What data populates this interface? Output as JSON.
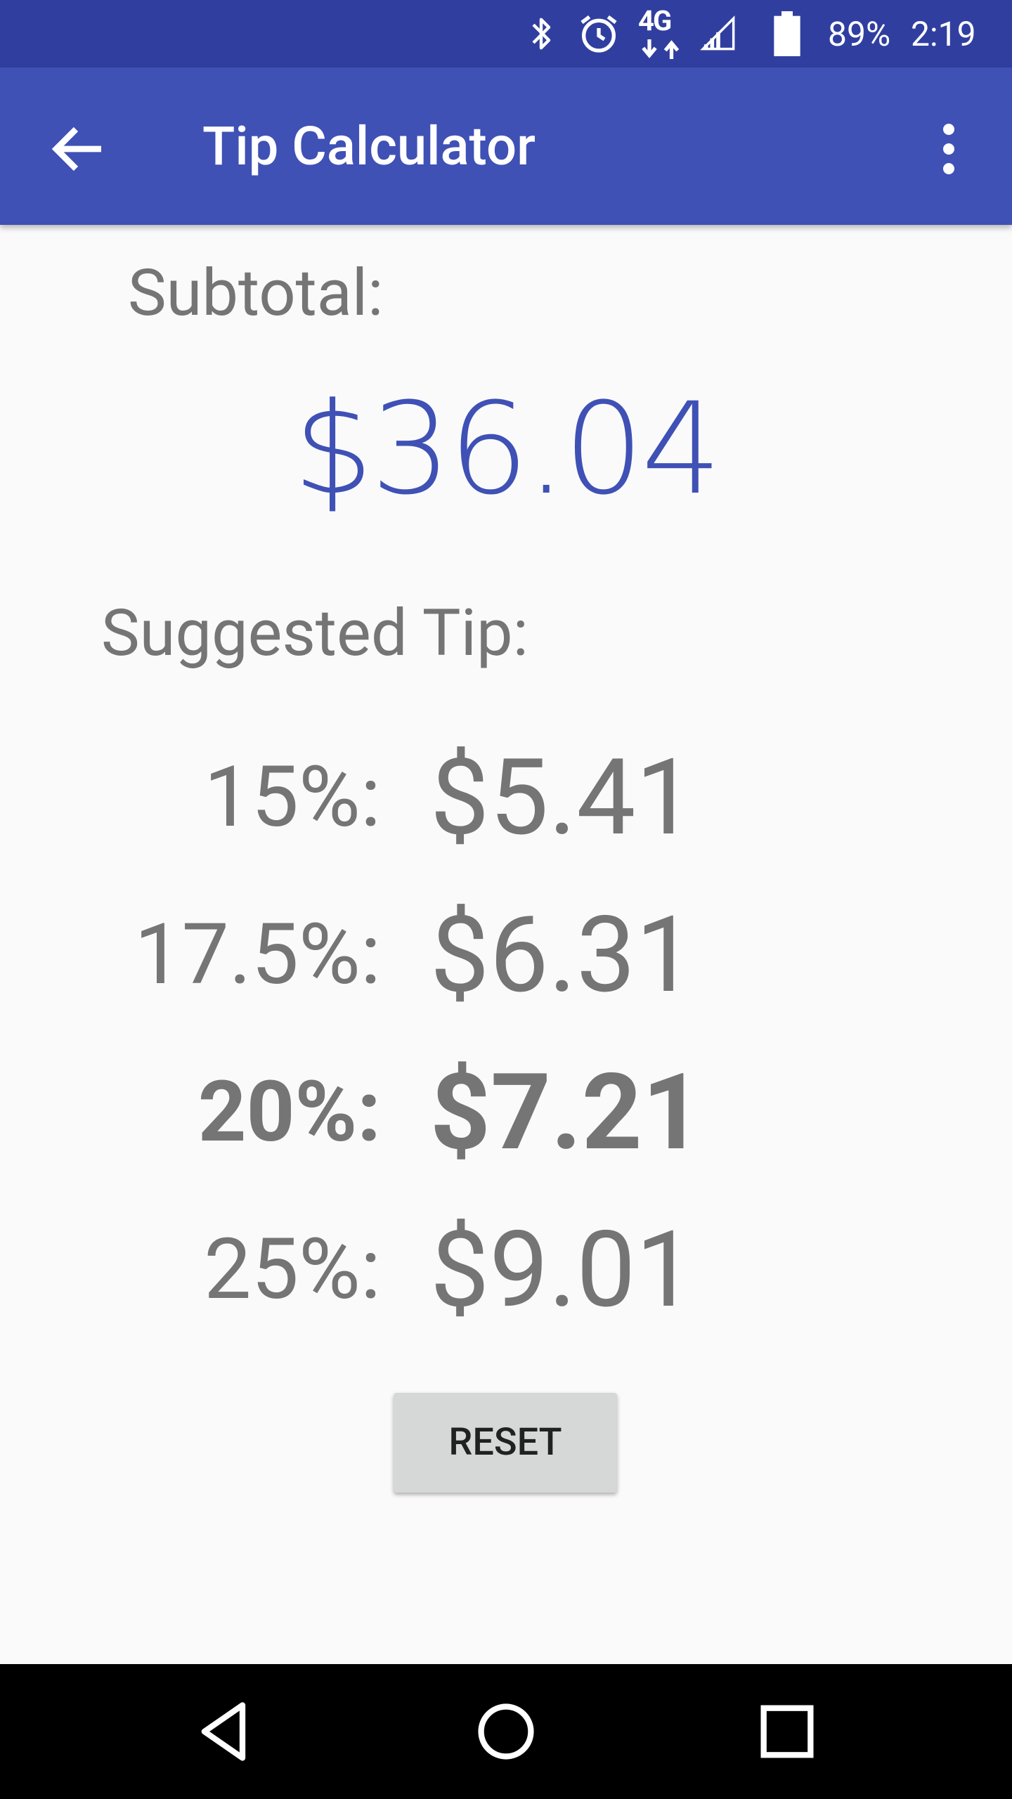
{
  "status_bar": {
    "icons": [
      "bluetooth-icon",
      "alarm-icon",
      "network-4g-lte-icon",
      "signal-icon",
      "battery-icon"
    ],
    "network_label": "4G",
    "battery": "89%",
    "time": "2:19"
  },
  "app_bar": {
    "title": "Tip Calculator",
    "back_icon": "arrow-back-icon",
    "menu_icon": "more-vert-icon"
  },
  "subtotal": {
    "label": "Subtotal:",
    "value": "$36.04"
  },
  "suggested": {
    "label": "Suggested Tip:",
    "tips": [
      {
        "percent": "15%:",
        "amount": "$5.41"
      },
      {
        "percent": "17.5%:",
        "amount": "$6.31"
      },
      {
        "percent": "20%:",
        "amount": "$7.21"
      },
      {
        "percent": "25%:",
        "amount": "$9.01"
      }
    ]
  },
  "reset_label": "RESET",
  "nav_bar": {
    "icons": [
      "back-triangle-icon",
      "home-circle-icon",
      "recents-square-icon"
    ]
  },
  "colors": {
    "status_bar": "#303f9f",
    "app_bar": "#3f51b5",
    "accent_text": "#3f51b5",
    "secondary_text": "#757575"
  }
}
